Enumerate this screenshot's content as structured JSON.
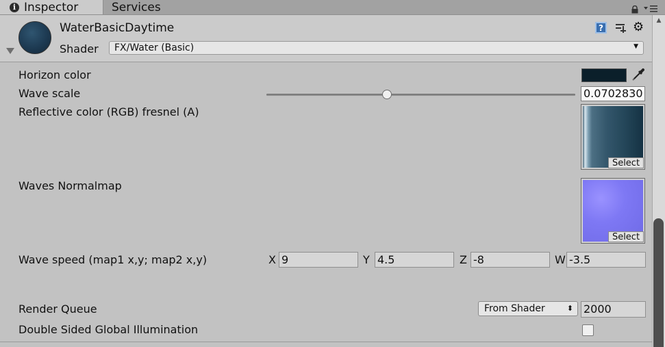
{
  "tabs": [
    {
      "label": "Inspector",
      "icon": "info-icon"
    },
    {
      "label": "Services"
    }
  ],
  "header": {
    "material_name": "WaterBasicDaytime",
    "shader_label": "Shader",
    "shader_value": "FX/Water (Basic)",
    "help_icon_glyph": "?"
  },
  "properties": {
    "horizon_color": {
      "label": "Horizon color",
      "color": "#0b1f2a"
    },
    "wave_scale": {
      "label": "Wave scale",
      "value": "0.0702830",
      "slider_fraction": 0.39
    },
    "reflective_color": {
      "label": "Reflective color (RGB) fresnel (A)",
      "select_label": "Select"
    },
    "waves_normalmap": {
      "label": "Waves Normalmap",
      "select_label": "Select"
    },
    "wave_speed": {
      "label": "Wave speed (map1 x,y; map2 x,y)",
      "components": [
        {
          "axis": "X",
          "value": "9"
        },
        {
          "axis": "Y",
          "value": "4.5"
        },
        {
          "axis": "Z",
          "value": "-8"
        },
        {
          "axis": "W",
          "value": "-3.5"
        }
      ]
    },
    "render_queue": {
      "label": "Render Queue",
      "mode": "From Shader",
      "value": "2000"
    },
    "double_sided_gi": {
      "label": "Double Sided Global Illumination",
      "checked": false
    }
  },
  "colors": {
    "panel_bg": "#c2c2c2",
    "header_bg": "#cbcbcb",
    "scroll_thumb": "#4e4e4e"
  }
}
